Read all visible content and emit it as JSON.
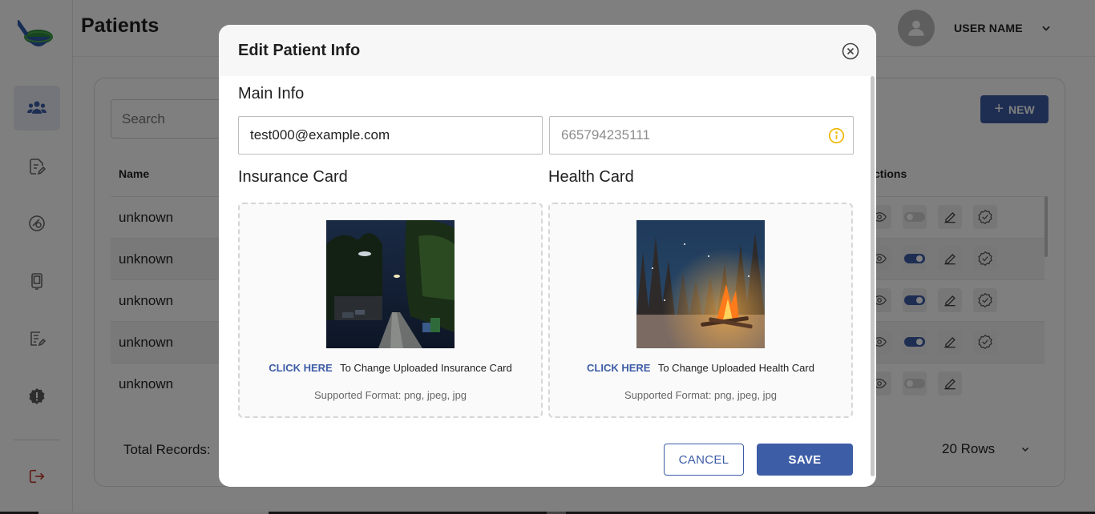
{
  "app": {
    "page_title": "Patients",
    "user": {
      "name": "USER NAME"
    },
    "sidebar": {
      "items": [
        {
          "icon": "users-icon",
          "active": true
        },
        {
          "icon": "document-edit-icon",
          "active": false
        },
        {
          "icon": "medication-icon",
          "active": false
        },
        {
          "icon": "device-icon",
          "active": false
        },
        {
          "icon": "report-edit-icon",
          "active": false
        },
        {
          "icon": "alert-badge-icon",
          "active": false
        }
      ],
      "logout_icon": "logout-icon"
    },
    "table": {
      "search_placeholder": "Search",
      "new_button_label": "NEW",
      "columns": {
        "name": "Name",
        "actions": "ctions"
      },
      "rows": [
        {
          "name": "unknown",
          "toggle_on": false,
          "verified_icon": true
        },
        {
          "name": "unknown",
          "toggle_on": true,
          "verified_icon": true
        },
        {
          "name": "unknown",
          "toggle_on": true,
          "verified_icon": true
        },
        {
          "name": "unknown",
          "toggle_on": true,
          "verified_icon": true
        },
        {
          "name": "unknown",
          "toggle_on": false,
          "verified_icon": false
        }
      ],
      "total_records_label": "Total Records:",
      "rows_per_page": "20 Rows"
    }
  },
  "modal": {
    "title": "Edit Patient Info",
    "main_info_label": "Main Info",
    "email_value": "test000@example.com",
    "phone_placeholder": "665794235111",
    "insurance": {
      "label": "Insurance Card",
      "click_here": "CLICK HERE",
      "change_text": "To Change Uploaded Insurance Card",
      "formats": "Supported Format: png, jpeg, jpg"
    },
    "health": {
      "label": "Health Card",
      "click_here": "CLICK HERE",
      "change_text": "To Change Uploaded Health Card",
      "formats": "Supported Format: png, jpeg, jpg"
    },
    "cancel_label": "CANCEL",
    "save_label": "SAVE"
  },
  "colors": {
    "primary": "#3d5da7",
    "warning": "#f2b705",
    "logout": "#c0392b"
  }
}
